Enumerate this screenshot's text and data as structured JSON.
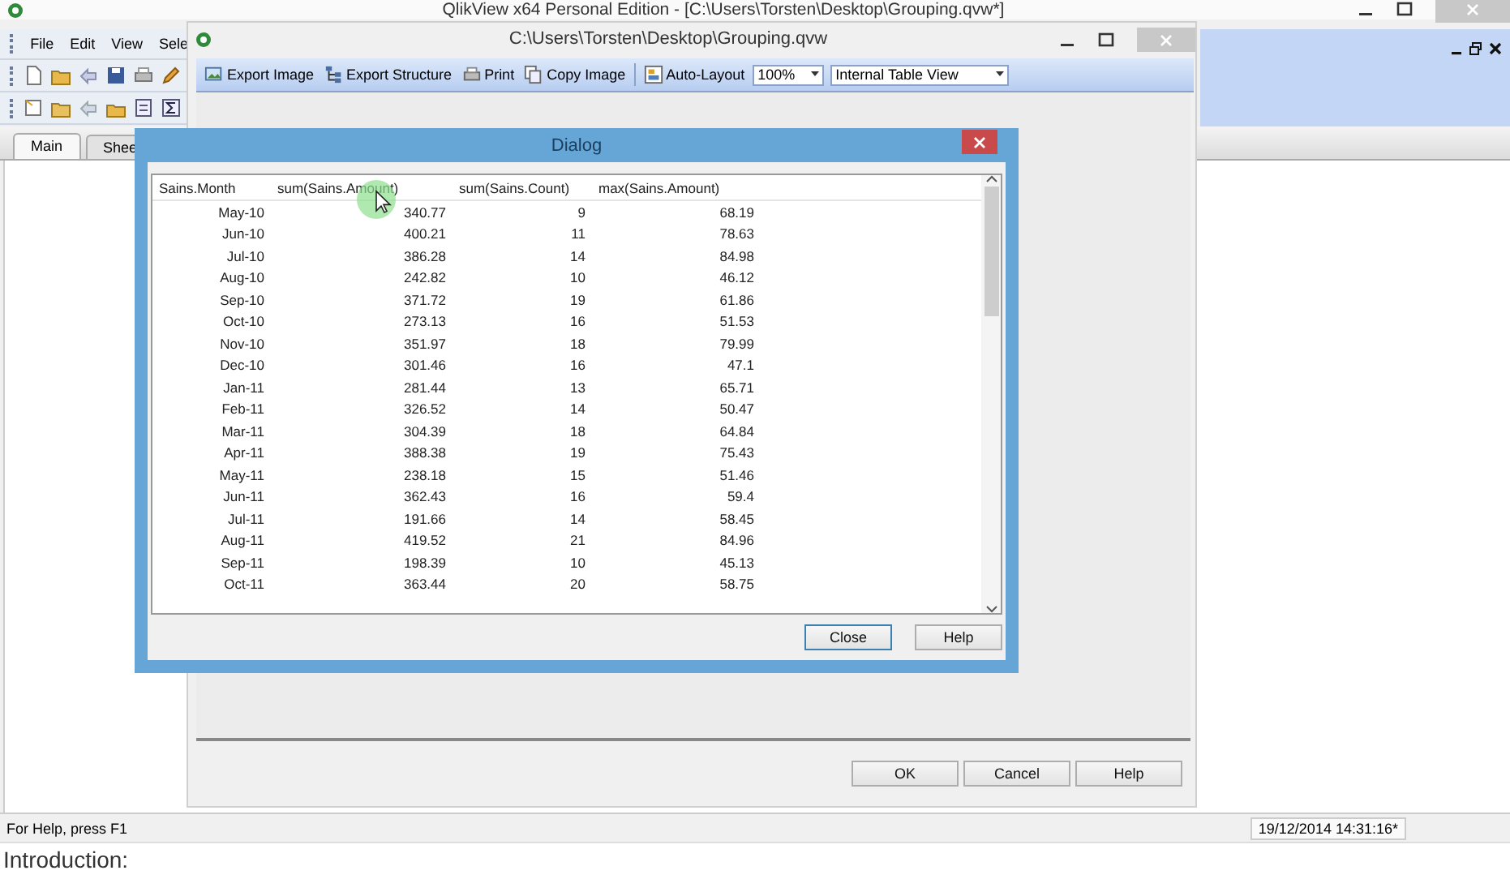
{
  "main_window": {
    "title": "QlikView x64 Personal Edition - [C:\\Users\\Torsten\\Desktop\\Grouping.qvw*]",
    "menu": [
      "File",
      "Edit",
      "View",
      "Sele"
    ],
    "sheet_tabs": [
      {
        "label": "Main",
        "selected": true
      },
      {
        "label": "Shee",
        "selected": false
      }
    ],
    "status_bar": {
      "help_text": "For Help, press F1",
      "timestamp": "19/12/2014 14:31:16*"
    }
  },
  "chart_window": {
    "title": "C:\\Users\\Torsten\\Desktop\\Grouping.qvw",
    "toolbar": [
      {
        "kind": "button",
        "label": "Export Image"
      },
      {
        "kind": "button",
        "label": "Export Structure"
      },
      {
        "kind": "button",
        "label": "Print"
      },
      {
        "kind": "button",
        "label": "Copy Image"
      },
      {
        "kind": "button",
        "label": "Auto-Layout"
      },
      {
        "kind": "dropdown",
        "value": "100%"
      },
      {
        "kind": "dropdown",
        "value": "Internal Table View"
      }
    ],
    "buttons": [
      "OK",
      "Cancel",
      "Help"
    ]
  },
  "dialog": {
    "title": "Dialog",
    "table": {
      "columns": [
        "Sains.Month",
        "sum(Sains.Amount)",
        "sum(Sains.Count)",
        "max(Sains.Amount)"
      ],
      "rows": [
        [
          "May-10",
          "340.77",
          "9",
          "68.19"
        ],
        [
          "Jun-10",
          "400.21",
          "11",
          "78.63"
        ],
        [
          "Jul-10",
          "386.28",
          "14",
          "84.98"
        ],
        [
          "Aug-10",
          "242.82",
          "10",
          "46.12"
        ],
        [
          "Sep-10",
          "371.72",
          "19",
          "61.86"
        ],
        [
          "Oct-10",
          "273.13",
          "16",
          "51.53"
        ],
        [
          "Nov-10",
          "351.97",
          "18",
          "79.99"
        ],
        [
          "Dec-10",
          "301.46",
          "16",
          "47.1"
        ],
        [
          "Jan-11",
          "281.44",
          "13",
          "65.71"
        ],
        [
          "Feb-11",
          "326.52",
          "14",
          "50.47"
        ],
        [
          "Mar-11",
          "304.39",
          "18",
          "64.84"
        ],
        [
          "Apr-11",
          "388.38",
          "19",
          "75.43"
        ],
        [
          "May-11",
          "238.18",
          "15",
          "51.46"
        ],
        [
          "Jun-11",
          "362.43",
          "16",
          "59.4"
        ],
        [
          "Jul-11",
          "191.66",
          "14",
          "58.45"
        ],
        [
          "Aug-11",
          "419.52",
          "21",
          "84.96"
        ],
        [
          "Sep-11",
          "198.39",
          "10",
          "45.13"
        ],
        [
          "Oct-11",
          "363.44",
          "20",
          "58.75"
        ]
      ]
    },
    "buttons": [
      {
        "label": "Close",
        "default": true
      },
      {
        "label": "Help",
        "default": false
      }
    ]
  },
  "page_text": "Introduction:"
}
